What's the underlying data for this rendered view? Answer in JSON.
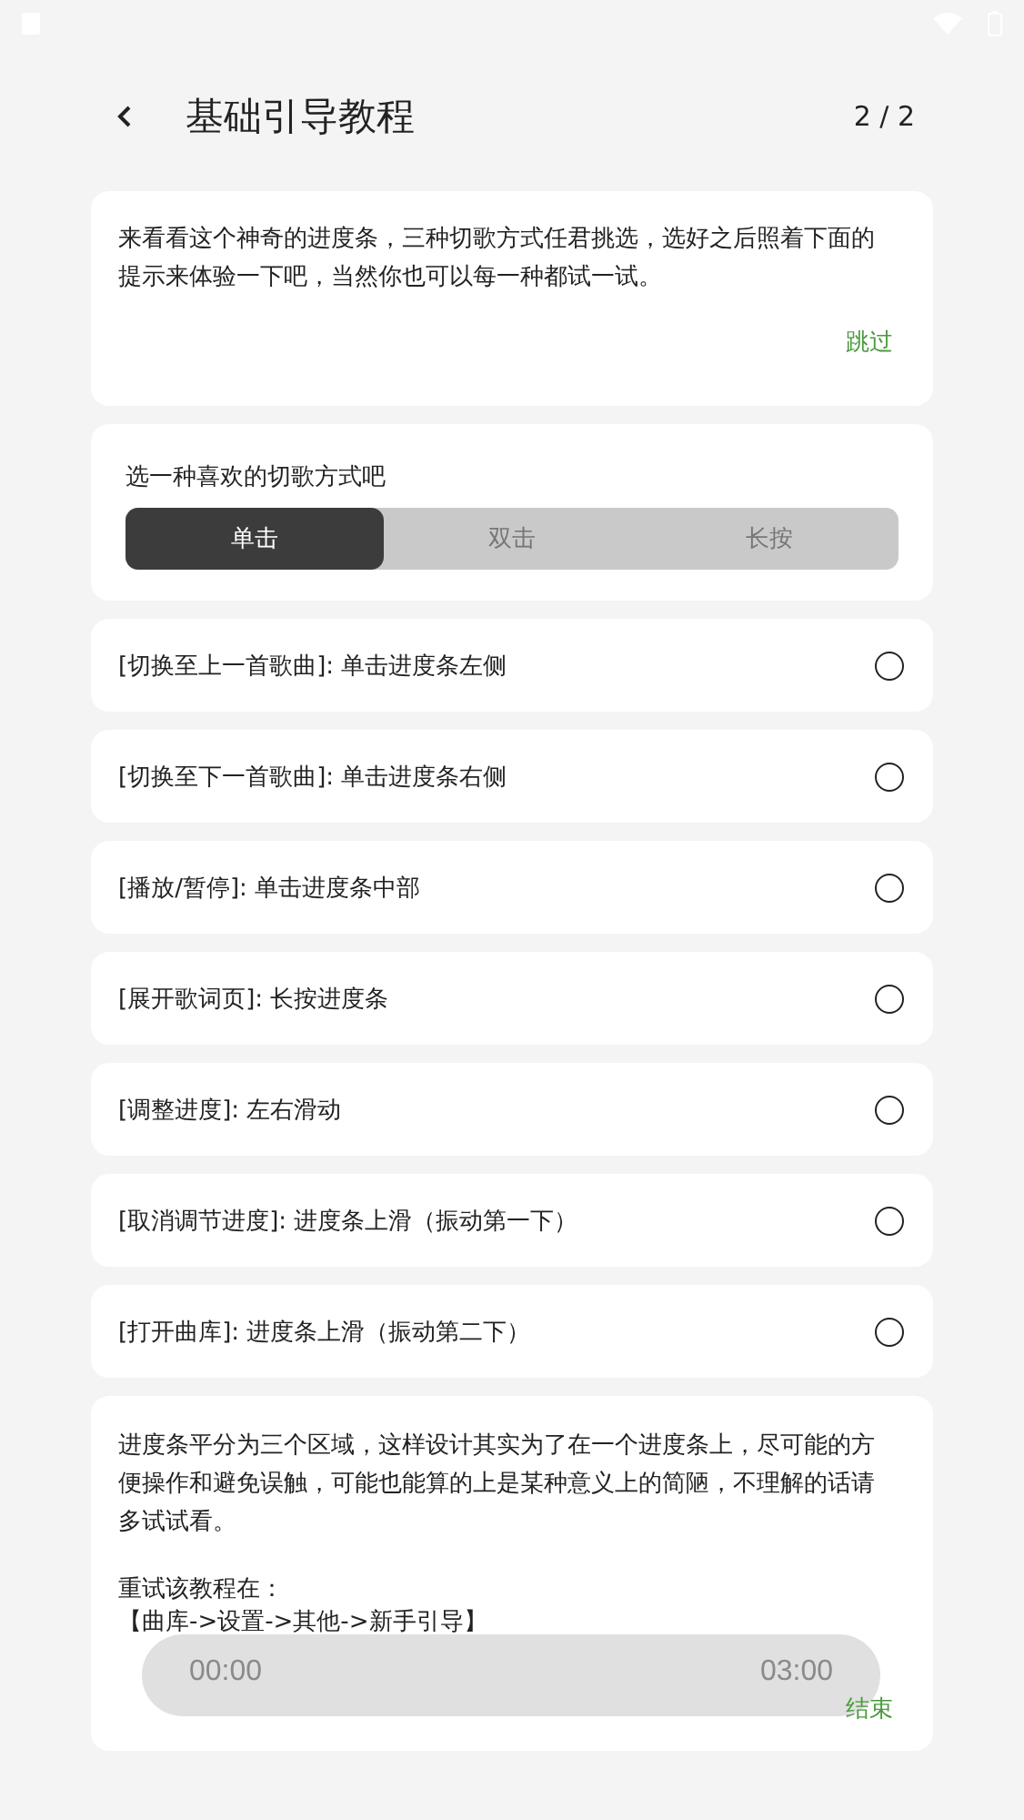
{
  "header": {
    "title": "基础引导教程",
    "page_indicator": "2 / 2"
  },
  "intro": {
    "text": "来看看这个神奇的进度条，三种切歌方式任君挑选，选好之后照着下面的提示来体验一下吧，当然你也可以每一种都试一试。",
    "skip": "跳过"
  },
  "mode_picker": {
    "label": "选一种喜欢的切歌方式吧",
    "options": [
      {
        "label": "单击",
        "selected": true
      },
      {
        "label": "双击",
        "selected": false
      },
      {
        "label": "长按",
        "selected": false
      }
    ]
  },
  "gestures": [
    {
      "text": "[切换至上一首歌曲]: 单击进度条左侧",
      "checked": false
    },
    {
      "text": "[切换至下一首歌曲]: 单击进度条右侧",
      "checked": false
    },
    {
      "text": "[播放/暂停]: 单击进度条中部",
      "checked": false
    },
    {
      "text": "[展开歌词页]: 长按进度条",
      "checked": false
    },
    {
      "text": "[调整进度]: 左右滑动",
      "checked": false
    },
    {
      "text": "[取消调节进度]: 进度条上滑（振动第一下）",
      "checked": false
    },
    {
      "text": "[打开曲库]: 进度条上滑（振动第二下）",
      "checked": false
    }
  ],
  "footer": {
    "text": "进度条平分为三个区域，这样设计其实为了在一个进度条上，尽可能的方便操作和避免误触，可能也能算的上是某种意义上的简陋，不理解的话请多试试看。",
    "retry_label": "重试该教程在：",
    "retry_path": "【曲库->设置->其他->新手引导】",
    "start_time": "00:00",
    "end_time": "03:00",
    "finish": "结束"
  }
}
